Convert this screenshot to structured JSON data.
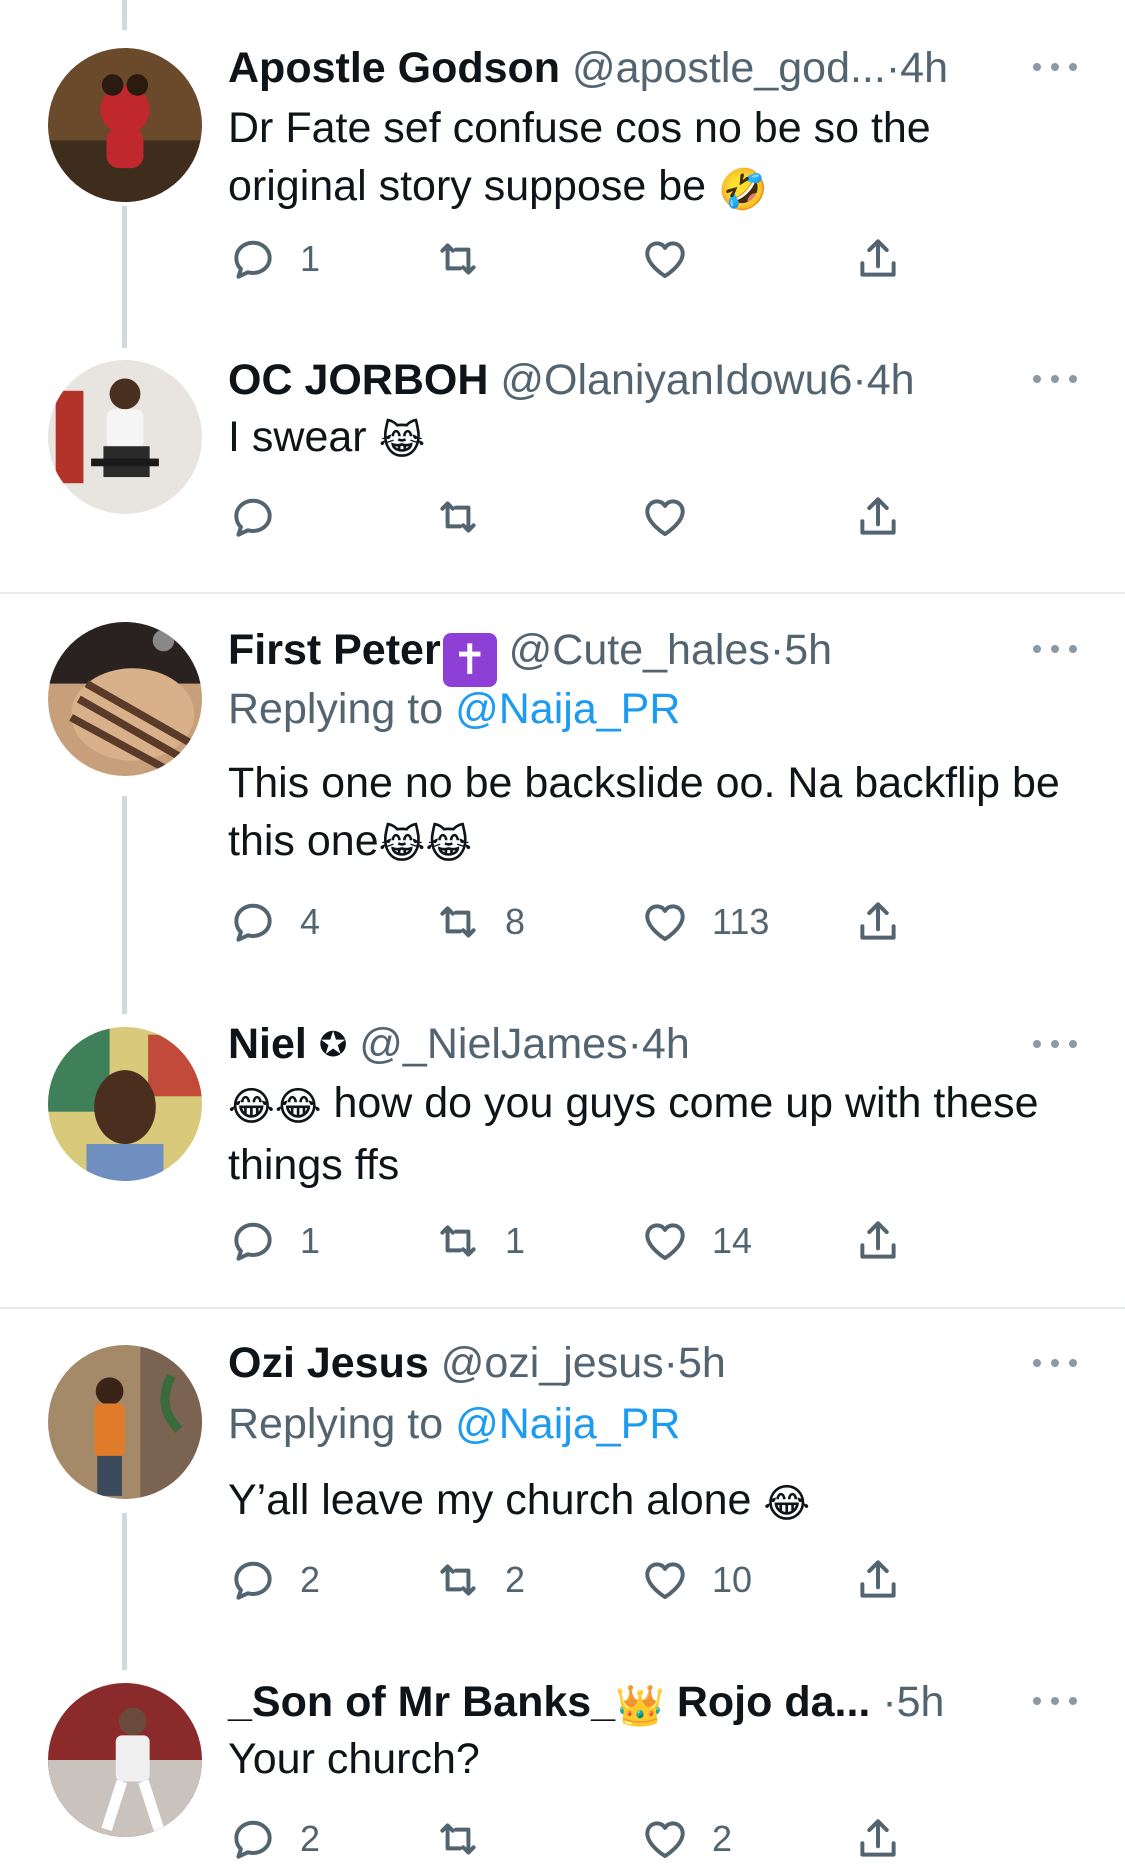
{
  "tweets": [
    {
      "name": "Apostle Godson",
      "handle": "@apostle_god...",
      "sep": "·",
      "time": "4h",
      "body_text": "Dr Fate sef confuse cos no be so the original story suppose be",
      "body_emoji": "🤣",
      "replies": "1",
      "retweets": "",
      "likes": ""
    },
    {
      "name": "OC JORBOH",
      "handle": "@OlaniyanIdowu6",
      "sep": "·",
      "time": "4h",
      "body_text": "I swear",
      "body_emoji": "😹",
      "replies": "",
      "retweets": "",
      "likes": ""
    },
    {
      "name": "First Peter",
      "badge": "✝",
      "handle": "@Cute_hales",
      "sep": "·",
      "time": "5h",
      "replying_label": "Replying to",
      "replying_to": "@Naija_PR",
      "body_text": "This one no be backslide oo. Na backflip be this one",
      "body_emoji": "😹😹",
      "replies": "4",
      "retweets": "8",
      "likes": "113"
    },
    {
      "name": "Niel",
      "name_symbol": "✪",
      "handle": "@_NielJames",
      "sep": "·",
      "time": "4h",
      "body_emoji": "😂😂",
      "body_text": "how do you guys come up with these things ffs",
      "replies": "1",
      "retweets": "1",
      "likes": "14"
    },
    {
      "name": "Ozi Jesus",
      "handle": "@ozi_jesus",
      "sep": "·",
      "time": "5h",
      "replying_label": "Replying to",
      "replying_to": "@Naija_PR",
      "body_text": "Y’all leave my church alone",
      "body_emoji": "😂",
      "replies": "2",
      "retweets": "2",
      "likes": "10"
    },
    {
      "name": "_Son of Mr Banks_",
      "name_emoji": "👑",
      "name_rest": "Rojo da...",
      "sep": "·",
      "time": "5h",
      "body_text": "Your church?",
      "replies": "2",
      "retweets": "",
      "likes": "2"
    }
  ],
  "icons": {
    "reply": "reply-icon",
    "retweet": "retweet-icon",
    "like": "heart-icon",
    "share": "share-icon",
    "more": "more-options-icon"
  },
  "colors": {
    "text": "#0f1419",
    "secondary": "#536471",
    "link": "#1d9bf0",
    "thread": "#cfd9de",
    "divider": "#e6ecf0"
  }
}
